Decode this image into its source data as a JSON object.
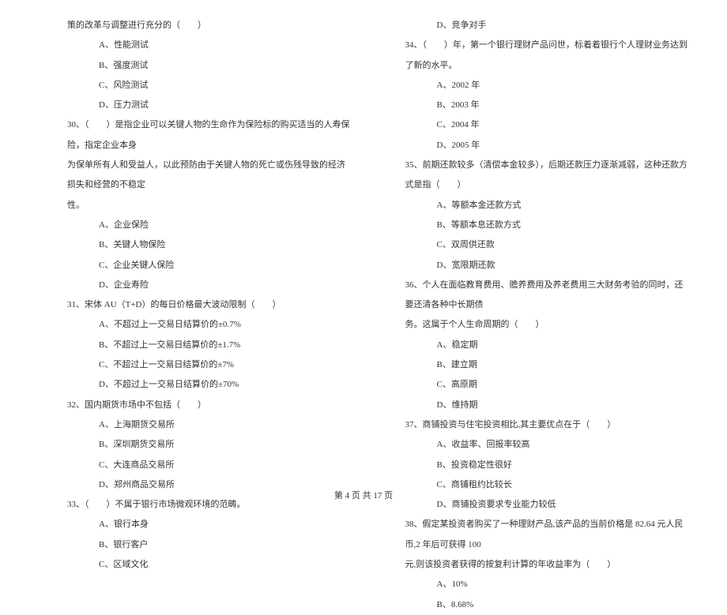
{
  "left_column": {
    "q29_tail": "策的改革与调整进行充分的（　　）",
    "q29_opts": [
      "A、性能测试",
      "B、强度测试",
      "C、风险测试",
      "D、压力测试"
    ],
    "q30_line1": "30、（　　）是指企业可以关键人物的生命作为保险标的购买适当的人寿保险，指定企业本身",
    "q30_line2": "为保单所有人和受益人，以此预防由于关键人物的死亡或伤残导致的经济损失和经营的不稳定",
    "q30_line3": "性。",
    "q30_opts": [
      "A、企业保险",
      "B、关键人物保险",
      "C、企业关键人保险",
      "D、企业寿险"
    ],
    "q31_stem": "31、宋体 AU（T+D）的每日价格最大波动限制（　　）",
    "q31_opts": [
      "A、不超过上一交易日结算价的±0.7%",
      "B、不超过上一交易日结算价的±1.7%",
      "C、不超过上一交易日结算价的±7%",
      "D、不超过上一交易日结算价的±70%"
    ],
    "q32_stem": "32、国内期货市场中不包括（　　）",
    "q32_opts": [
      "A、上海期货交易所",
      "B、深圳期货交易所",
      "C、大连商品交易所",
      "D、郑州商品交易所"
    ],
    "q33_stem": "33、（　　）不属于银行市场微观环境的范畴。",
    "q33_opts": [
      "A、银行本身",
      "B、银行客户",
      "C、区域文化"
    ]
  },
  "right_column": {
    "q33_opt_d": "D、竞争对手",
    "q34_stem": "34、（　　）年，第一个银行理财产品问世，标着着银行个人理财业务达到了新的水平。",
    "q34_opts": [
      "A、2002 年",
      "B、2003 年",
      "C、2004 年",
      "D、2005 年"
    ],
    "q35_stem": "35、前期还款较多（清偿本金较多），后期还款压力逐渐减弱，这种还款方式是指（　　）",
    "q35_opts": [
      "A、等额本金还款方式",
      "B、等额本息还款方式",
      "C、双周供还款",
      "D、宽限期还款"
    ],
    "q36_line1": "36、个人在面临教育费用、赡养费用及养老费用三大财务考验的同时，还要还清各种中长期债",
    "q36_line2": "务。这属于个人生命周期的（　　）",
    "q36_opts": [
      "A、稳定期",
      "B、建立期",
      "C、高原期",
      "D、维持期"
    ],
    "q37_stem": "37、商铺投资与住宅投资相比,其主要优点在于（　　）",
    "q37_opts": [
      "A、收益率、回报率较高",
      "B、投资稳定性很好",
      "C、商铺租约比较长",
      "D、商铺投资要求专业能力较低"
    ],
    "q38_line1": "38、假定某投资者购买了一种理财产品,该产品的当前价格是 82.64 元人民币,2 年后可获得 100",
    "q38_line2": "元,则该投资者获得的按复利计算的年收益率为（　　）",
    "q38_opts": [
      "A、10%",
      "B、8.68%"
    ]
  },
  "footer": "第 4 页 共 17 页"
}
